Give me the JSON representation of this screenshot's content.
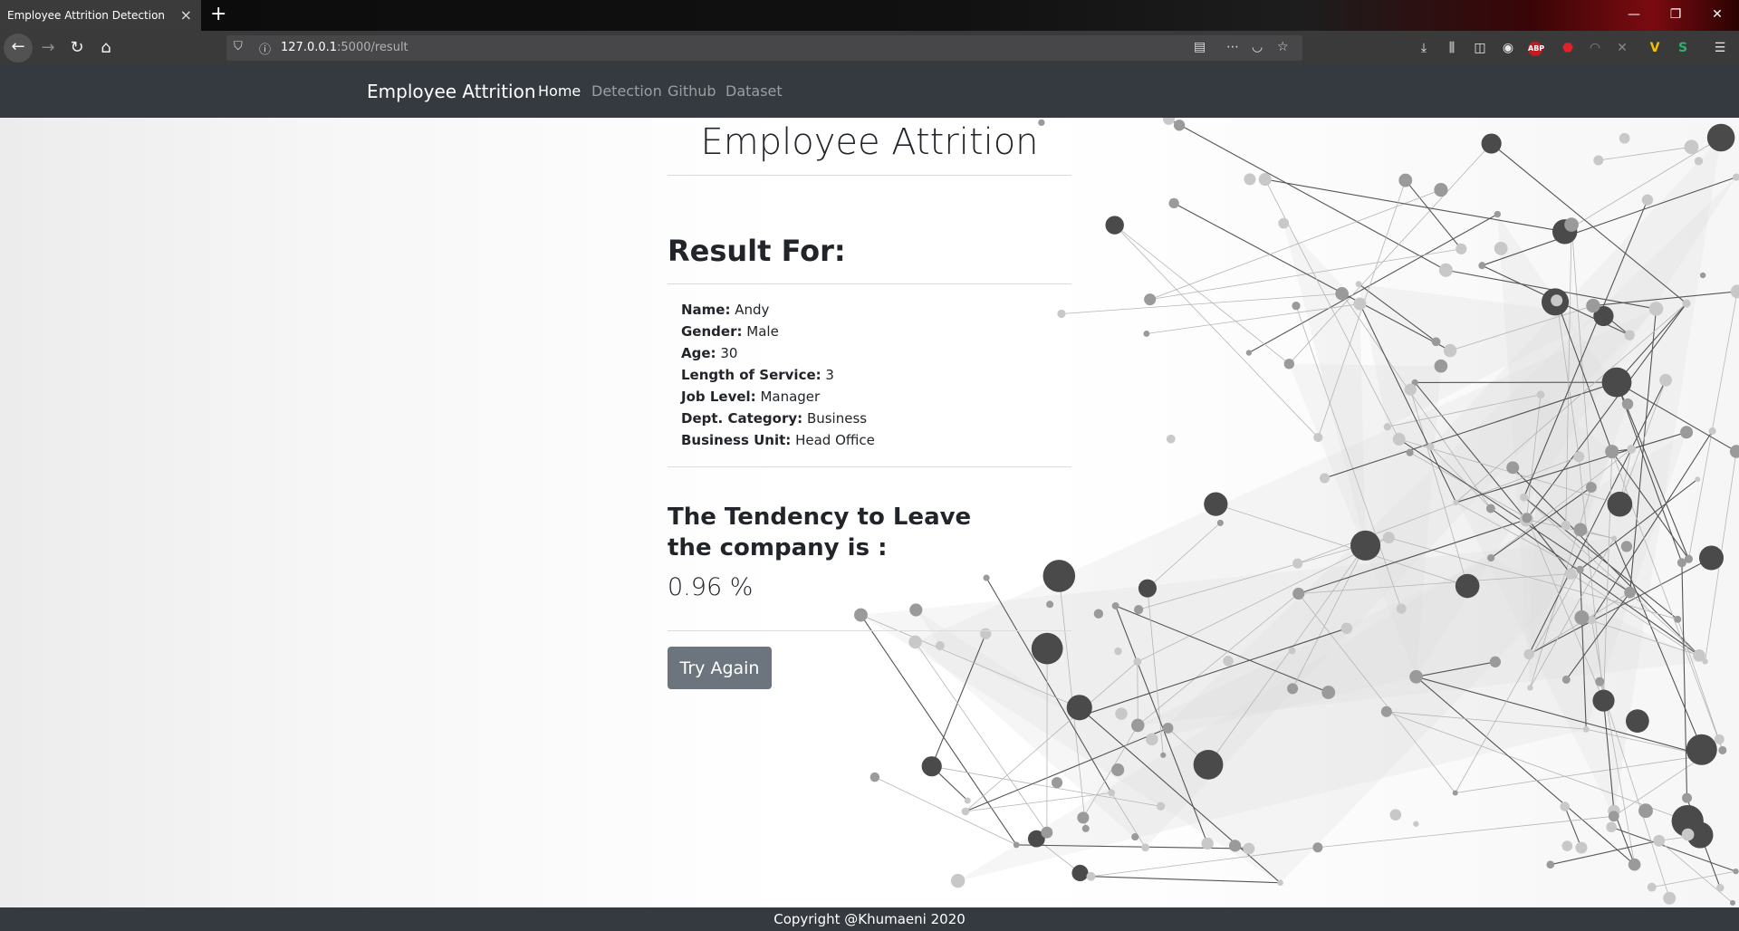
{
  "browser": {
    "tab_title": "Employee Attrition Detection",
    "tab_close": "×",
    "new_tab": "+",
    "url_host": "127.0.0.1",
    "url_path": ":5000/result",
    "window_controls": {
      "minimize": "—",
      "maximize": "❐",
      "close": "✕"
    },
    "extensions": {
      "abp": "ABP"
    }
  },
  "navbar": {
    "brand": "Employee Attrition",
    "links": [
      "Home",
      "Detection",
      "Github",
      "Dataset"
    ],
    "active": "Home"
  },
  "main": {
    "title": "Employee Attrition",
    "result_heading": "Result For:",
    "fields": [
      {
        "label": "Name:",
        "value": "Andy"
      },
      {
        "label": "Gender:",
        "value": "Male"
      },
      {
        "label": "Age:",
        "value": "30"
      },
      {
        "label": "Length of Service:",
        "value": "3"
      },
      {
        "label": "Job Level:",
        "value": "Manager"
      },
      {
        "label": "Dept. Category:",
        "value": "Business"
      },
      {
        "label": "Business Unit:",
        "value": "Head Office"
      }
    ],
    "tendency_heading": "The Tendency to Leave the company is :",
    "tendency_value": "0.96 %",
    "try_again_label": "Try Again"
  },
  "footer": {
    "text": "Copyright @Khumaeni 2020"
  },
  "colors": {
    "navbar_bg": "#343a40",
    "button_bg": "#6c757d",
    "browser_accent": "#d01c25"
  }
}
